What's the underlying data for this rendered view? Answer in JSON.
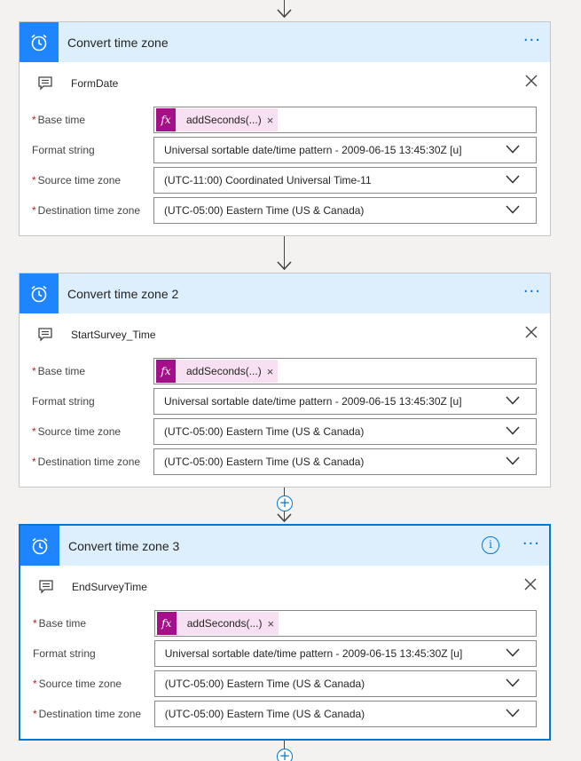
{
  "colors": {
    "accent": "#0078d4",
    "icon_bg": "#1f85ff",
    "header_bg": "#ddeefd",
    "token_bg": "#f7e0f1",
    "token_fx_bg": "#a4108a",
    "required": "#a4262c"
  },
  "cards": [
    {
      "title": "Convert time zone",
      "comment": "FormDate",
      "base_time_label": "Base time",
      "base_time_token": "addSeconds(...)",
      "format_label": "Format string",
      "format_value": "Universal sortable date/time pattern - 2009-06-15 13:45:30Z [u]",
      "source_label": "Source time zone",
      "source_value": "(UTC-11:00) Coordinated Universal Time-11",
      "dest_label": "Destination time zone",
      "dest_value": "(UTC-05:00) Eastern Time (US & Canada)"
    },
    {
      "title": "Convert time zone 2",
      "comment": "StartSurvey_Time",
      "base_time_label": "Base time",
      "base_time_token": "addSeconds(...)",
      "format_label": "Format string",
      "format_value": "Universal sortable date/time pattern - 2009-06-15 13:45:30Z [u]",
      "source_label": "Source time zone",
      "source_value": "(UTC-05:00) Eastern Time (US & Canada)",
      "dest_label": "Destination time zone",
      "dest_value": "(UTC-05:00) Eastern Time (US & Canada)"
    },
    {
      "title": "Convert time zone 3",
      "comment": "EndSurveyTime",
      "base_time_label": "Base time",
      "base_time_token": "addSeconds(...)",
      "format_label": "Format string",
      "format_value": "Universal sortable date/time pattern - 2009-06-15 13:45:30Z [u]",
      "source_label": "Source time zone",
      "source_value": "(UTC-05:00) Eastern Time (US & Canada)",
      "dest_label": "Destination time zone",
      "dest_value": "(UTC-05:00) Eastern Time (US & Canada)"
    }
  ],
  "icons": {
    "action": "alarm-clock-icon",
    "comment": "comment-icon",
    "close": "close-icon",
    "more": "more-options-icon",
    "info": "info-icon",
    "add": "add-step-icon",
    "dropdown": "chevron-down-icon"
  },
  "glyphs": {
    "more": "···",
    "info": "i",
    "plus": "+",
    "fx": "fx",
    "remove": "×",
    "required": "*"
  }
}
